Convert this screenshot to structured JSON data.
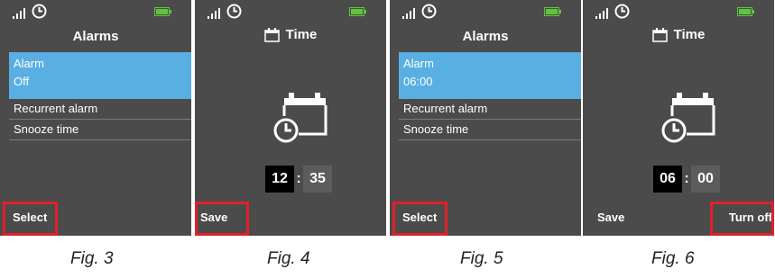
{
  "figures": [
    {
      "id": "fig3",
      "caption": "Fig. 3",
      "title": "Alarms",
      "selected_item": {
        "line1": "Alarm",
        "line2": "Off"
      },
      "menu_items": [
        "Recurrent alarm",
        "Snooze time"
      ],
      "softkey_left": "Select",
      "softkey_right": ""
    },
    {
      "id": "fig4",
      "caption": "Fig. 4",
      "title": "Time",
      "time": {
        "hours": "12",
        "separator": ":",
        "minutes": "35"
      },
      "softkey_left": "Save",
      "softkey_right": ""
    },
    {
      "id": "fig5",
      "caption": "Fig. 5",
      "title": "Alarms",
      "selected_item": {
        "line1": "Alarm",
        "line2": "06:00"
      },
      "menu_items": [
        "Recurrent alarm",
        "Snooze time"
      ],
      "softkey_left": "Select",
      "softkey_right": ""
    },
    {
      "id": "fig6",
      "caption": "Fig. 6",
      "title": "Time",
      "time": {
        "hours": "06",
        "separator": ":",
        "minutes": "00"
      },
      "softkey_left": "Save",
      "softkey_right": "Turn off"
    }
  ],
  "colors": {
    "screen_bg": "#4b4b4b",
    "selection": "#5aafe2",
    "highlight_box": "#e0202a",
    "battery": "#5ec63a"
  },
  "icons": [
    "signal-icon",
    "clock-icon",
    "battery-icon",
    "calendar-clock-icon",
    "calendar-icon"
  ]
}
